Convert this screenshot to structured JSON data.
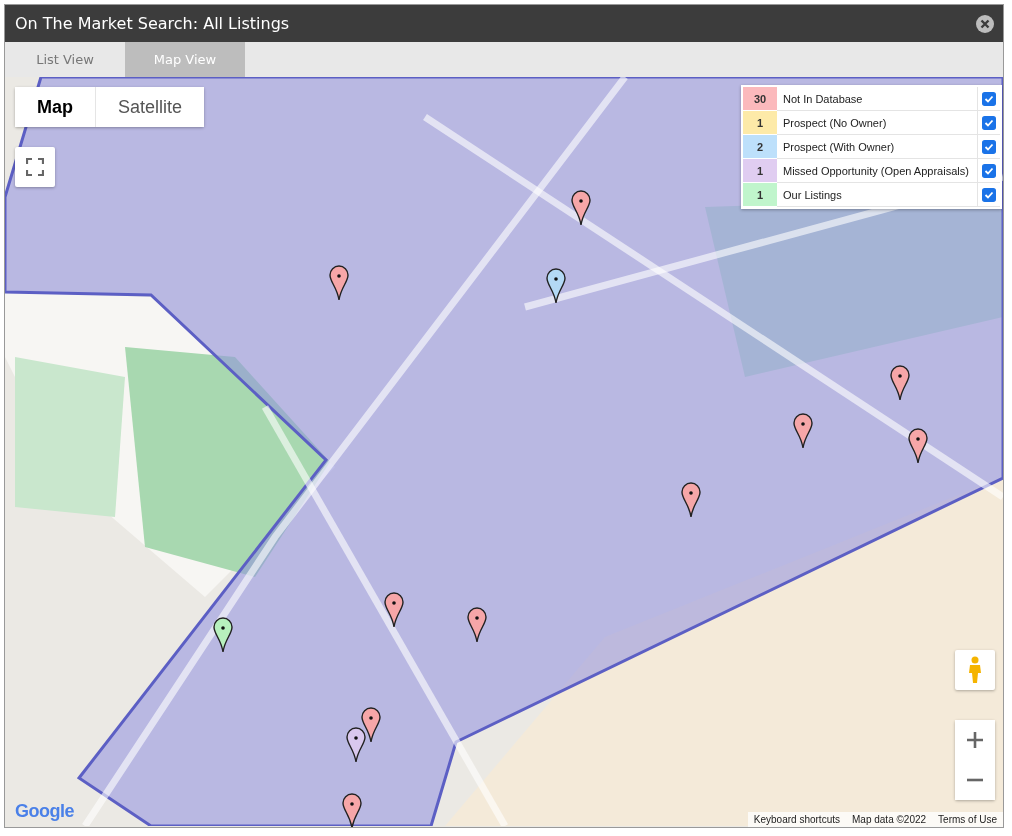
{
  "window": {
    "title": "On The Market Search: All Listings"
  },
  "tabs": [
    {
      "label": "List View",
      "selected": false
    },
    {
      "label": "Map View",
      "selected": true
    }
  ],
  "map": {
    "type_toggle": [
      {
        "label": "Map",
        "selected": true
      },
      {
        "label": "Satellite",
        "selected": false
      }
    ],
    "legend": [
      {
        "count": "30",
        "label": "Not In Database",
        "color": "#fbb9bc",
        "checked": true
      },
      {
        "count": "1",
        "label": "Prospect (No Owner)",
        "color": "#fdeaa8",
        "checked": true
      },
      {
        "count": "2",
        "label": "Prospect (With Owner)",
        "color": "#bde0fb",
        "checked": true
      },
      {
        "count": "1",
        "label": "Missed Opportunity (Open Appraisals)",
        "color": "#e0cdf1",
        "checked": true
      },
      {
        "count": "1",
        "label": "Our Listings",
        "color": "#c0f5cc",
        "checked": true
      }
    ],
    "markers": [
      {
        "color": "#f6a6a8"
      },
      {
        "color": "#f6a6a8"
      },
      {
        "color": "#b3d9f5"
      },
      {
        "color": "#f6a6a8"
      },
      {
        "color": "#f6a6a8"
      },
      {
        "color": "#f6a6a8"
      },
      {
        "color": "#f6a6a8"
      },
      {
        "color": "#f6a6a8"
      },
      {
        "color": "#f6a6a8"
      },
      {
        "color": "#b7f0bd"
      },
      {
        "color": "#f6a6a8"
      },
      {
        "color": "#d9c8ee"
      },
      {
        "color": "#f6a6a8"
      }
    ],
    "logo": "Google",
    "footer": [
      "Keyboard shortcuts",
      "Map data ©2022",
      "Terms of Use"
    ]
  }
}
